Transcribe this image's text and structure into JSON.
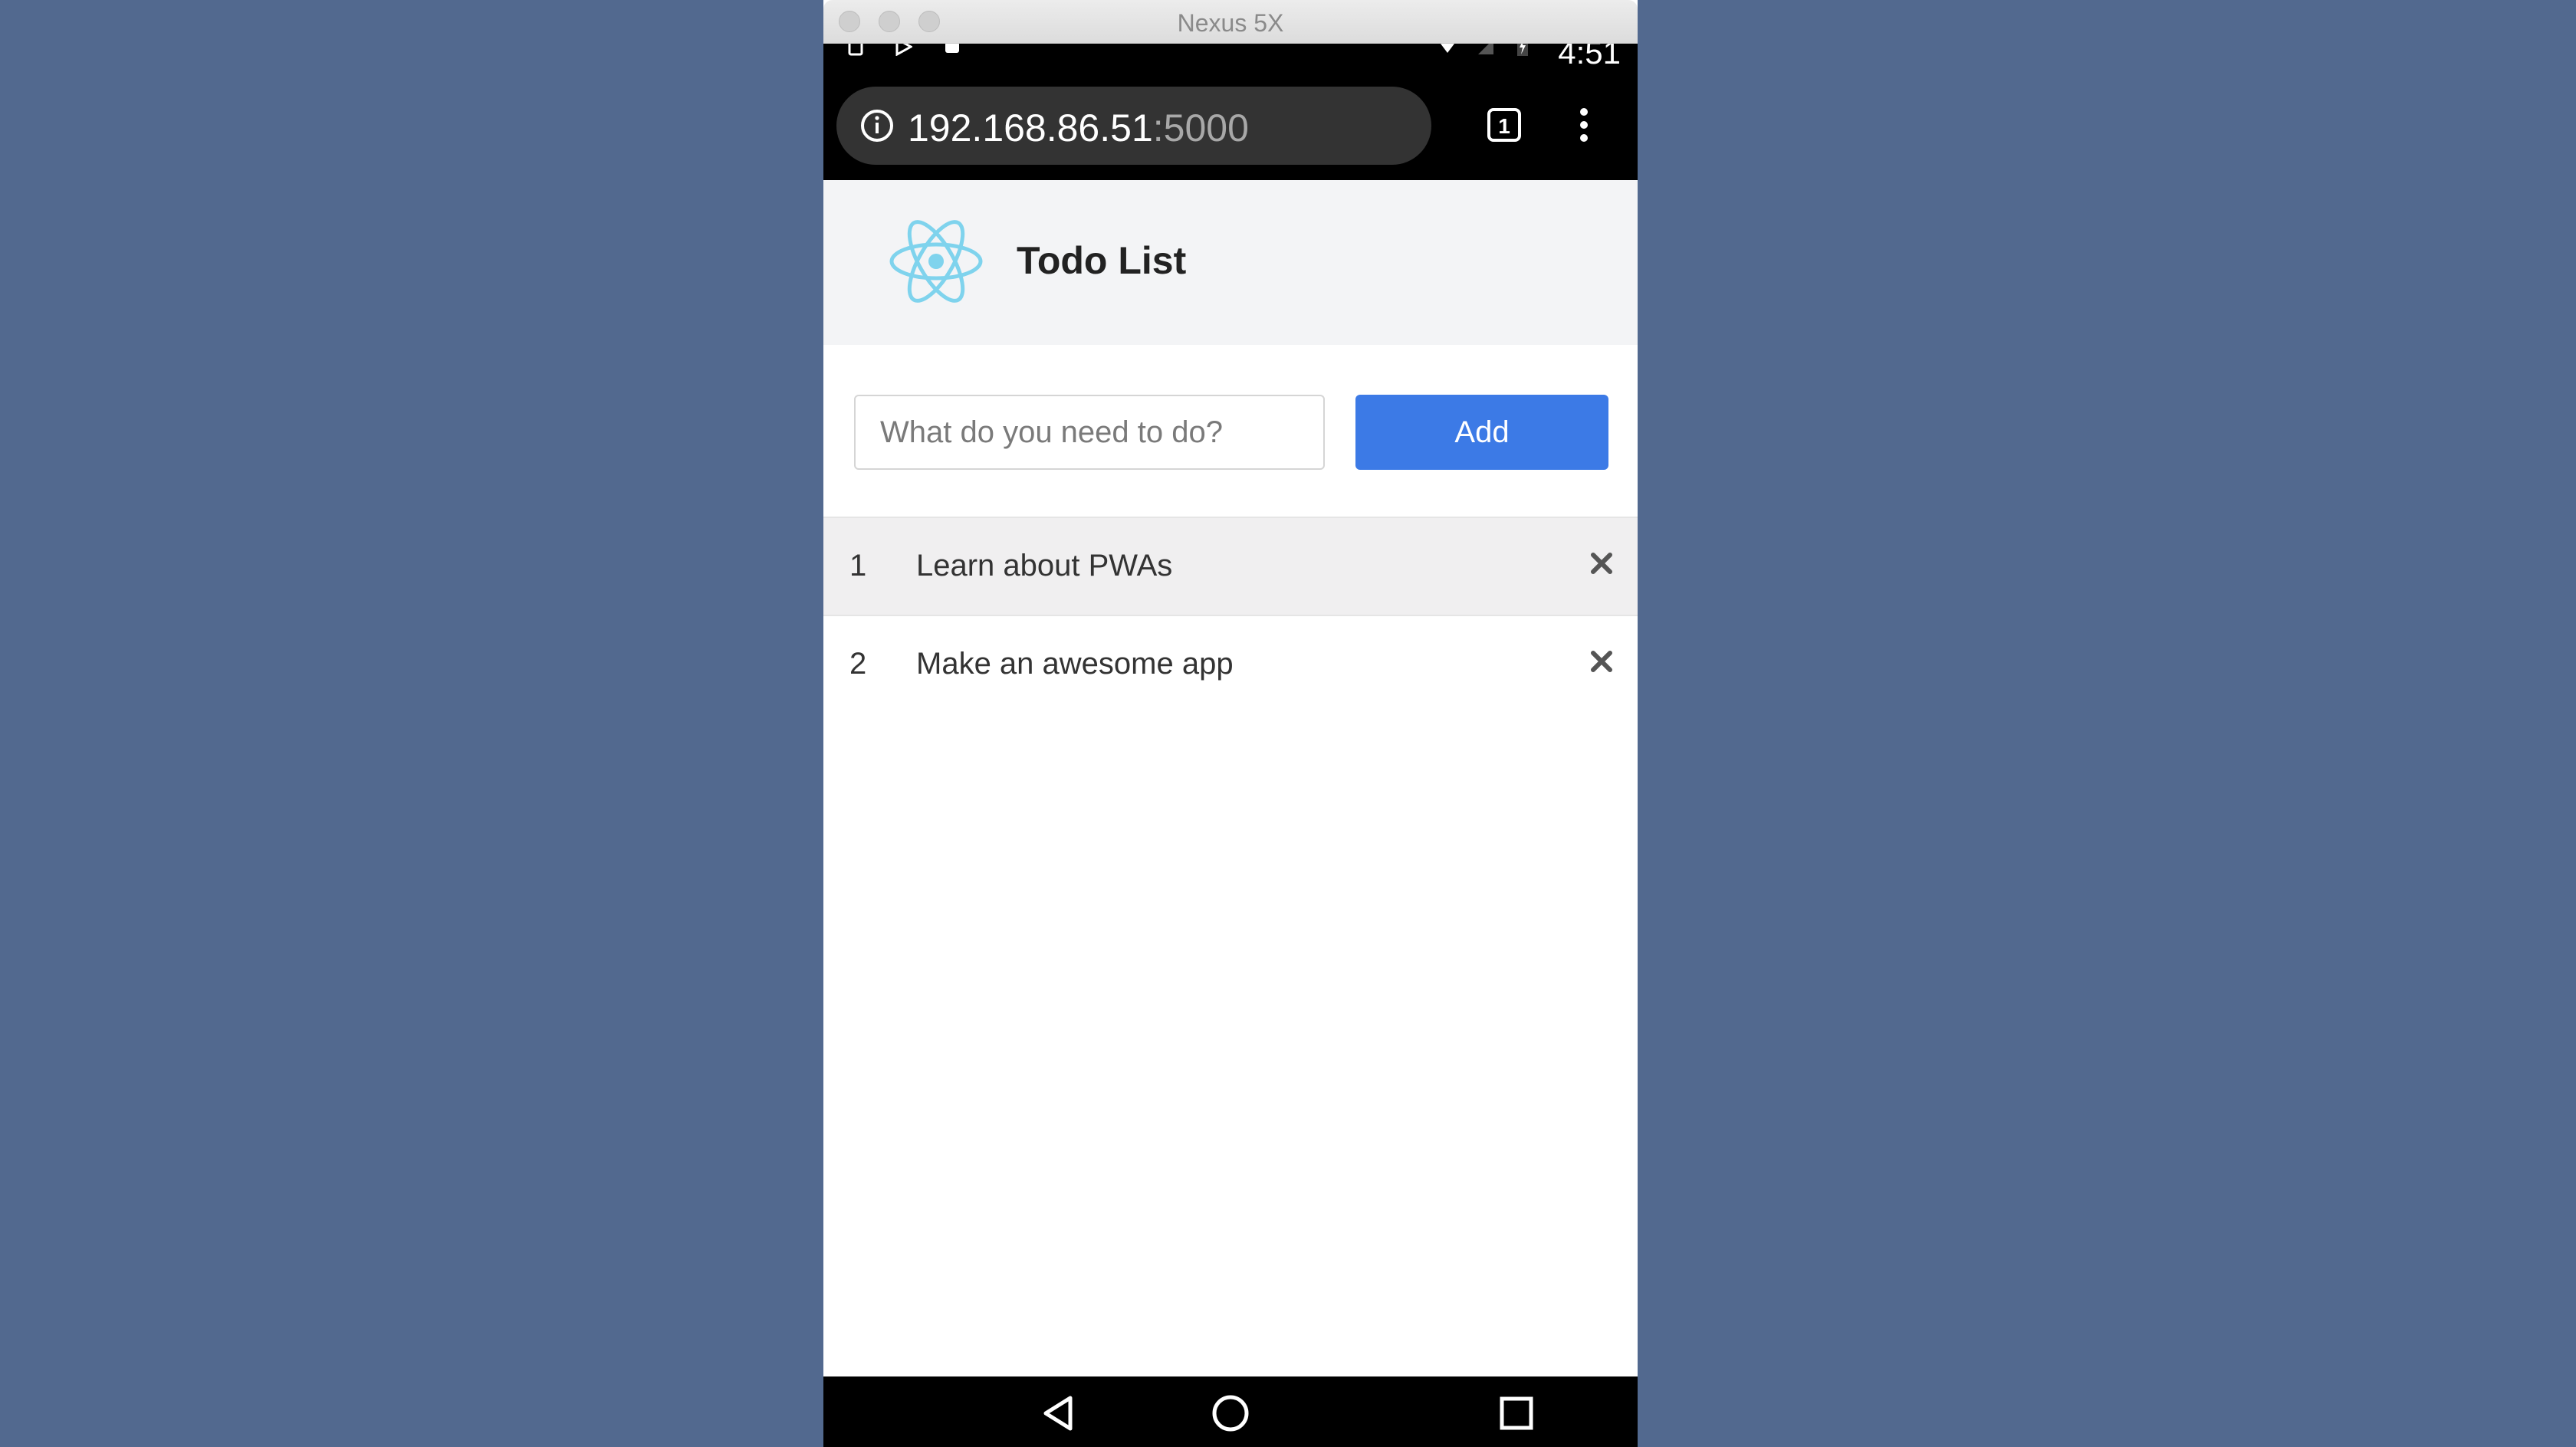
{
  "window": {
    "title": "Nexus 5X"
  },
  "status_bar": {
    "time": "4:51"
  },
  "browser": {
    "url_host": "192.168.86.51",
    "url_port": ":5000",
    "tab_count": "1"
  },
  "app": {
    "title": "Todo List"
  },
  "form": {
    "placeholder": "What do you need to do?",
    "value": "",
    "add_label": "Add"
  },
  "todos": [
    {
      "number": "1",
      "text": "Learn about PWAs"
    },
    {
      "number": "2",
      "text": "Make an awesome app"
    }
  ],
  "colors": {
    "desktop_bg": "#52698f",
    "accent": "#3c7ae6",
    "react_logo": "#7fd3ed"
  }
}
